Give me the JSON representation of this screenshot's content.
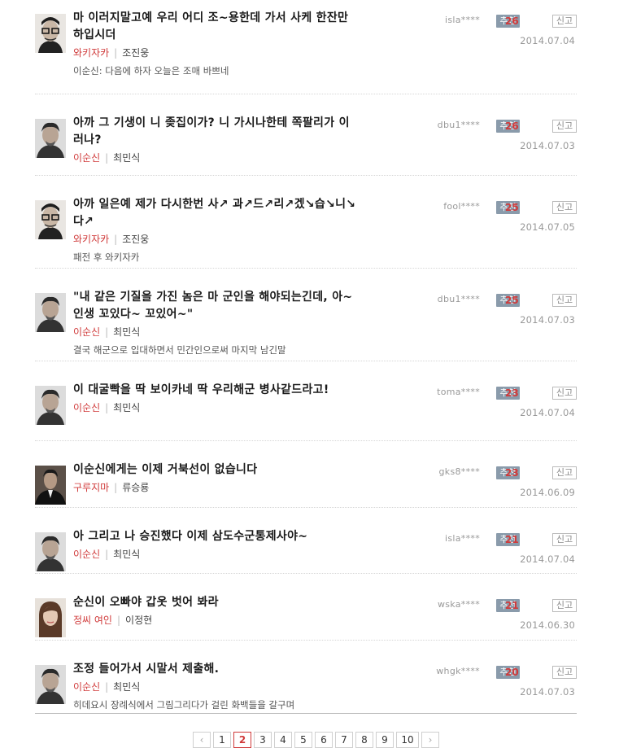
{
  "recommend_label": "추천",
  "report_label": "신고",
  "comments": [
    {
      "quote": "마 이러지말고예 우리 어디 조~용한데 가서 사케 한잔만 하입시더",
      "role": "와키자카",
      "actor": "조진웅",
      "note": "이순신: 다음에 하자 오늘은 조매 바쁘네",
      "user": "isla****",
      "recommends": "26",
      "date": "2014.07.04",
      "avatar": "avatar-glasses"
    },
    {
      "quote": "아까 그 기생이 니 좆집이가? 니 가시나한테 쪽팔리가 이러나?",
      "role": "이순신",
      "actor": "최민식",
      "note": "",
      "user": "dbu1****",
      "recommends": "26",
      "date": "2014.07.03",
      "avatar": "avatar-man"
    },
    {
      "quote": "아까 일은예 제가 다시한번 사↗ 과↗드↗리↗겠↘습↘니↘다↗",
      "role": "와키자카",
      "actor": "조진웅",
      "note": "패전 후 와키자카",
      "user": "fool****",
      "recommends": "25",
      "date": "2014.07.05",
      "avatar": "avatar-glasses"
    },
    {
      "quote": "\"내 같은 기질을 가진 놈은 마 군인을 해야되는긴데, 아~ 인생 꼬있다~ 꼬있어~\"",
      "role": "이순신",
      "actor": "최민식",
      "note": "결국 해군으로 입대하면서 민간인으로써 마지막 남긴말",
      "user": "dbu1****",
      "recommends": "25",
      "date": "2014.07.03",
      "avatar": "avatar-man"
    },
    {
      "quote": "이 대굴빡을 딱 보이카네 딱 우리해군 병사같드라고!",
      "role": "이순신",
      "actor": "최민식",
      "note": "",
      "user": "toma****",
      "recommends": "23",
      "date": "2014.07.04",
      "avatar": "avatar-man"
    },
    {
      "quote": "이순신에게는 이제 거북선이 없습니다",
      "role": "구루지마",
      "actor": "류승룡",
      "note": "",
      "user": "gks8****",
      "recommends": "23",
      "date": "2014.06.09",
      "avatar": "avatar-suit"
    },
    {
      "quote": "아 그리고 나 승진했다 이제 삼도수군통제사야~",
      "role": "이순신",
      "actor": "최민식",
      "note": "",
      "user": "isla****",
      "recommends": "21",
      "date": "2014.07.04",
      "avatar": "avatar-man"
    },
    {
      "quote": "순신이 오빠야 갑옷 벗어 봐라",
      "role": "정씨 여인",
      "actor": "이정현",
      "note": "",
      "user": "wska****",
      "recommends": "21",
      "date": "2014.06.30",
      "avatar": "avatar-woman"
    },
    {
      "quote": "조정 들어가서 시말서 제출해.",
      "role": "이순신",
      "actor": "최민식",
      "note": "히데요시 장례식에서 그림그리다가 걸린 화백들을 갈구며",
      "user": "whgk****",
      "recommends": "20",
      "date": "2014.07.03",
      "avatar": "avatar-man"
    }
  ],
  "pagination": {
    "prev": "‹",
    "pages": [
      "1",
      "2",
      "3",
      "4",
      "5",
      "6",
      "7",
      "8",
      "9",
      "10"
    ],
    "active": "2",
    "next": "›"
  }
}
